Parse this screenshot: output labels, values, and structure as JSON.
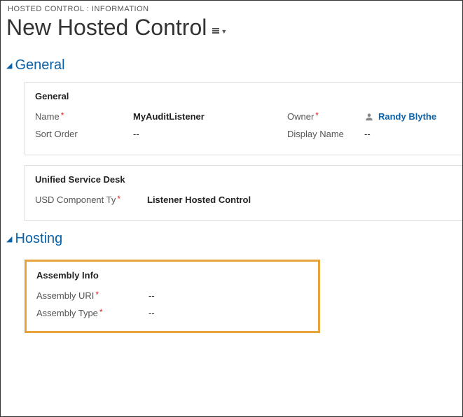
{
  "breadcrumb": "HOSTED CONTROL : INFORMATION",
  "page_title": "New Hosted Control",
  "sections": {
    "general": {
      "title": "General",
      "panel_general": {
        "title": "General",
        "name_label": "Name",
        "name_value": "MyAuditListener",
        "owner_label": "Owner",
        "owner_value": "Randy Blythe",
        "sort_order_label": "Sort Order",
        "sort_order_value": "--",
        "display_name_label": "Display Name",
        "display_name_value": "--"
      },
      "panel_usd": {
        "title": "Unified Service Desk",
        "component_label": "USD Component Ty",
        "component_value": "Listener Hosted Control"
      }
    },
    "hosting": {
      "title": "Hosting",
      "panel_assembly": {
        "title": "Assembly Info",
        "uri_label": "Assembly URI",
        "uri_value": "--",
        "type_label": "Assembly Type",
        "type_value": "--"
      }
    }
  }
}
